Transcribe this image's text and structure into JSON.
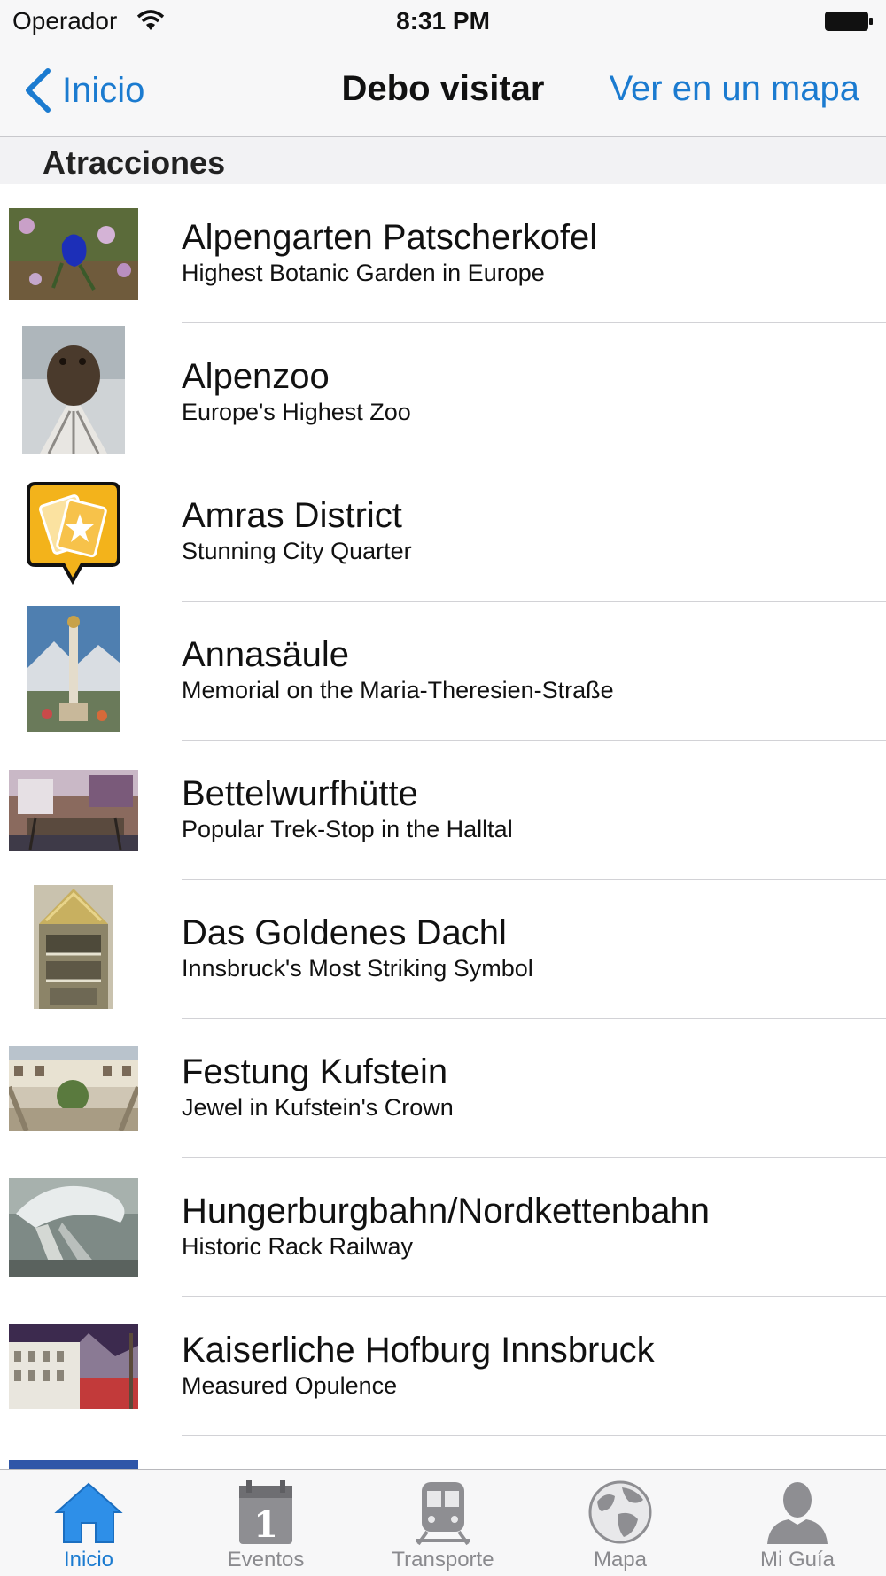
{
  "status_bar": {
    "carrier": "Operador",
    "time": "8:31 PM"
  },
  "nav": {
    "back_label": "Inicio",
    "title": "Debo visitar",
    "right_label": "Ver en un mapa"
  },
  "section": {
    "title": "Atracciones"
  },
  "items": [
    {
      "title": "Alpengarten Patscherkofel",
      "subtitle": "Highest Botanic Garden in Europe"
    },
    {
      "title": "Alpenzoo",
      "subtitle": "Europe's Highest Zoo"
    },
    {
      "title": "Amras District",
      "subtitle": "Stunning City Quarter"
    },
    {
      "title": "Annasäule",
      "subtitle": "Memorial on the Maria-Theresien-Straße"
    },
    {
      "title": "Bettelwurfhütte",
      "subtitle": "Popular Trek-Stop in the Halltal"
    },
    {
      "title": "Das Goldenes Dachl",
      "subtitle": "Innsbruck's Most Striking Symbol"
    },
    {
      "title": "Festung Kufstein",
      "subtitle": "Jewel in Kufstein's Crown"
    },
    {
      "title": "Hungerburgbahn/Nordkettenbahn",
      "subtitle": "Historic Rack Railway"
    },
    {
      "title": "Kaiserliche Hofburg Innsbruck",
      "subtitle": "Measured Opulence"
    }
  ],
  "tabs": [
    {
      "label": "Inicio",
      "icon": "home-icon",
      "active": true
    },
    {
      "label": "Eventos",
      "icon": "calendar-icon",
      "active": false
    },
    {
      "label": "Transporte",
      "icon": "train-icon",
      "active": false
    },
    {
      "label": "Mapa",
      "icon": "globe-icon",
      "active": false
    },
    {
      "label": "Mi Guía",
      "icon": "person-icon",
      "active": false
    }
  ],
  "colors": {
    "accent": "#1b7bd0",
    "inactive": "#8a8a8e"
  }
}
